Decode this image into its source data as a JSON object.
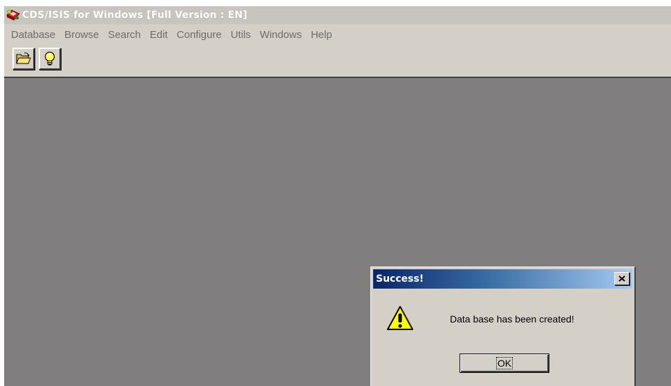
{
  "window": {
    "title": "CDS/ISIS for Windows [Full Version : EN]",
    "icon": "cds-isis-app-icon"
  },
  "menubar": {
    "items": [
      {
        "label": "Database"
      },
      {
        "label": "Browse"
      },
      {
        "label": "Search"
      },
      {
        "label": "Edit"
      },
      {
        "label": "Configure"
      },
      {
        "label": "Utils"
      },
      {
        "label": "Windows"
      },
      {
        "label": "Help"
      }
    ]
  },
  "toolbar": {
    "buttons": [
      {
        "icon": "open-folder-icon"
      },
      {
        "icon": "lightbulb-icon"
      }
    ]
  },
  "dialog": {
    "title": "Success!",
    "close_label": "x",
    "message": "Data base has been created!",
    "ok_label": "OK",
    "icon": "warning-icon"
  },
  "colors": {
    "workspace": "#807e7f",
    "face": "#d4d0c8",
    "dialog_title_start": "#0a246a",
    "dialog_title_end": "#a6caf0"
  }
}
